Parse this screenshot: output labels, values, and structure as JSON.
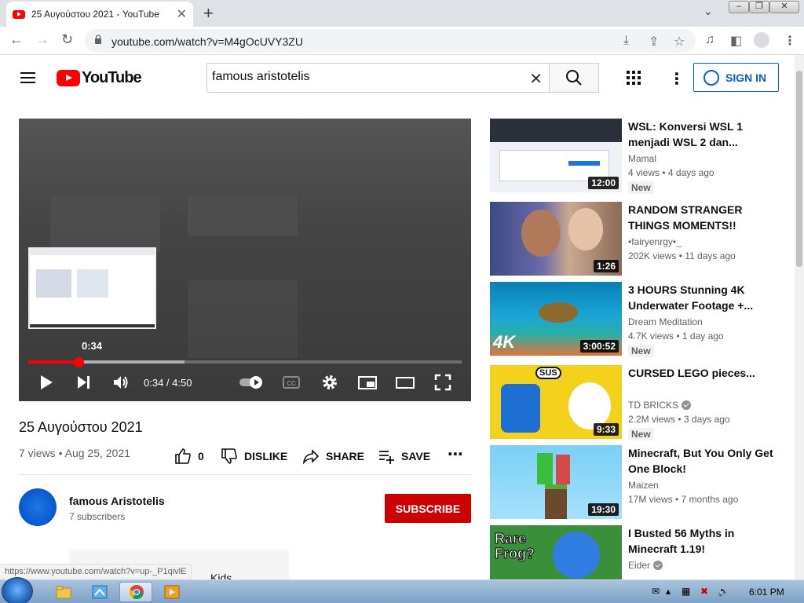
{
  "browser": {
    "tab_title": "25 Αυγούστου 2021 - YouTube",
    "url": "youtube.com/watch?v=M4gOcUVY3ZU",
    "status_url": "https://www.youtube.com/watch?v=up-_P1qivlE"
  },
  "header": {
    "logo_text": "YouTube",
    "search_value": "famous aristotelis",
    "signin_label": "SIGN IN"
  },
  "player": {
    "hover_time": "0:34",
    "time_display": "0:34 / 4:50",
    "played_fraction": 0.117,
    "buffered_fraction": 0.36
  },
  "video": {
    "title": "25 Αυγούστου 2021",
    "views": "7 views",
    "date": "Aug 25, 2021",
    "likes": "0",
    "dislike_label": "DISLIKE",
    "share_label": "SHARE",
    "save_label": "SAVE"
  },
  "channel": {
    "name": "famous Aristotelis",
    "subscribers": "7 subscribers",
    "subscribe_label": "SUBSCRIBE"
  },
  "partial_text": "Kids",
  "recommendations": [
    {
      "title": "WSL: Konversi WSL 1 menjadi WSL 2 dan...",
      "channel": "Mamal",
      "stats": "4 views • 4 days ago",
      "badge": "New",
      "duration": "12:00",
      "verified": false
    },
    {
      "title": "RANDOM STRANGER THINGS MOMENTS!!",
      "channel": "•fairyenrgy•_",
      "stats": "202K views • 11 days ago",
      "badge": "",
      "duration": "1:26",
      "verified": false
    },
    {
      "title": "3 HOURS Stunning 4K Underwater Footage +...",
      "channel": "Dream Meditation",
      "stats": "4.7K views • 1 day ago",
      "badge": "New",
      "duration": "3:00:52",
      "verified": false,
      "thumb_text": "4K"
    },
    {
      "title": "CURSED LEGO pieces...",
      "channel": "TD BRICKS",
      "stats": "2.2M views • 3 days ago",
      "badge": "New",
      "duration": "9:33",
      "verified": true,
      "thumb_text": "SUS"
    },
    {
      "title": "Minecraft, But You Only Get One Block!",
      "channel": "Maizen",
      "stats": "17M views • 7 months ago",
      "badge": "",
      "duration": "19:30",
      "verified": false
    },
    {
      "title": "I Busted 56 Myths in Minecraft 1.19!",
      "channel": "Eider",
      "stats": "",
      "badge": "",
      "duration": "",
      "verified": true,
      "thumb_text": "Rare Frog?"
    }
  ],
  "taskbar": {
    "clock": "6:01 PM"
  },
  "colors": {
    "yt_red": "#ff0000",
    "subscribe_red": "#cc0000",
    "signin_blue": "#065fd4"
  }
}
